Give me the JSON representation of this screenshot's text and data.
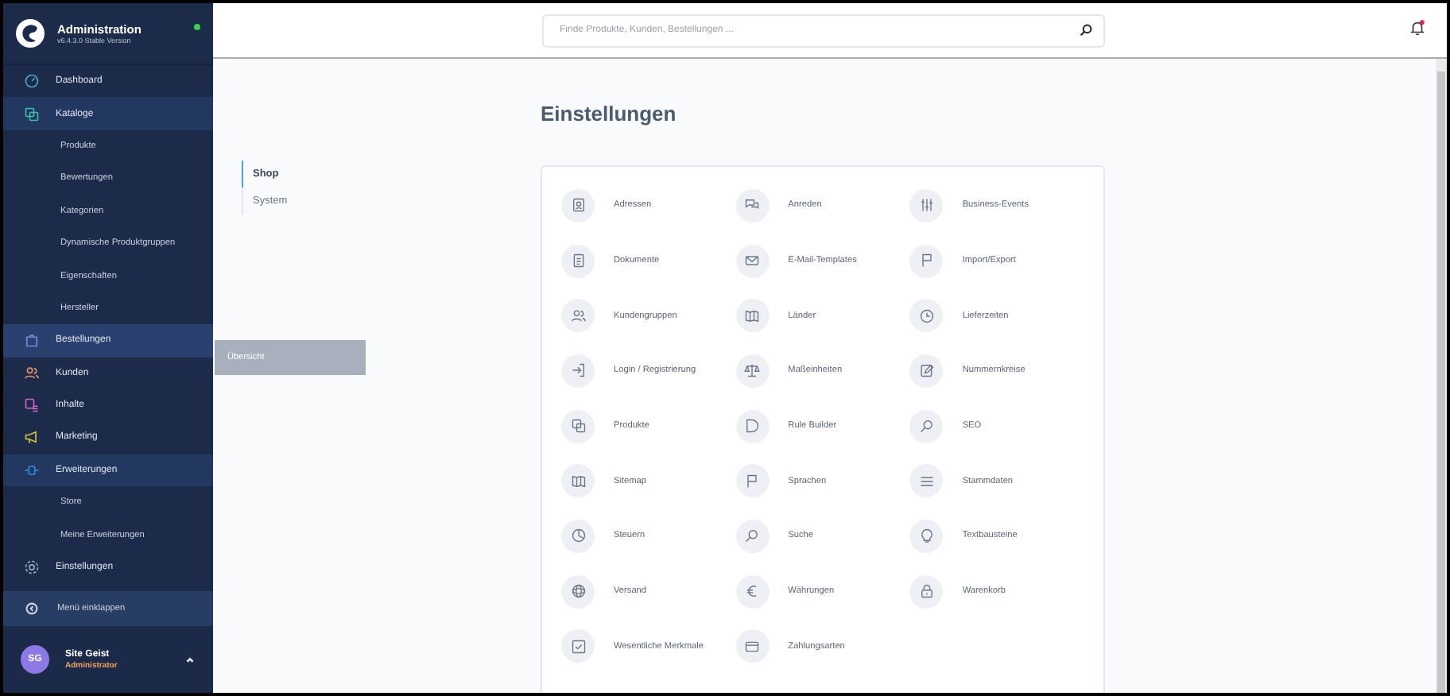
{
  "sidebar": {
    "title": "Administration",
    "version": "v6.4.3.0 Stable Version",
    "online": true,
    "items": [
      {
        "label": "Dashboard",
        "color": "#4fa8c9",
        "expanded": false,
        "selected": false
      },
      {
        "label": "Kataloge",
        "color": "#3fbf9e",
        "expanded": true,
        "selected": false,
        "children": [
          {
            "label": "Produkte"
          },
          {
            "label": "Bewertungen"
          },
          {
            "label": "Kategorien"
          },
          {
            "label": "Dynamische Produktgruppen"
          },
          {
            "label": "Eigenschaften"
          },
          {
            "label": "Hersteller"
          }
        ]
      },
      {
        "label": "Bestellungen",
        "color": "#6c8fd8",
        "expanded": false,
        "selected": true
      },
      {
        "label": "Kunden",
        "color": "#e8906a",
        "expanded": false,
        "selected": false
      },
      {
        "label": "Inhalte",
        "color": "#d062c9",
        "expanded": false,
        "selected": false
      },
      {
        "label": "Marketing",
        "color": "#d6c43a",
        "expanded": false,
        "selected": false
      },
      {
        "label": "Erweiterungen",
        "color": "#2f8fe0",
        "expanded": true,
        "selected": false,
        "children": [
          {
            "label": "Store"
          },
          {
            "label": "Meine Erweiterungen"
          }
        ]
      },
      {
        "label": "Einstellungen",
        "color": "#9aa5b8",
        "expanded": false,
        "selected": false
      }
    ],
    "flyout": [
      "Übersicht"
    ],
    "collapse": "Menü einklappen",
    "user": {
      "initials": "SG",
      "name": "Site Geist",
      "role": "Administrator"
    }
  },
  "search": {
    "placeholder": "Finde Produkte, Kunden, Bestellungen ..."
  },
  "notification": true,
  "page_title": "Einstellungen",
  "tabs": [
    {
      "label": "Shop",
      "selected": true
    },
    {
      "label": "System",
      "selected": false
    }
  ],
  "settings": [
    {
      "label": "Adressen"
    },
    {
      "label": "Anreden"
    },
    {
      "label": "Business-Events"
    },
    {
      "label": "Dokumente"
    },
    {
      "label": "E-Mail-Templates"
    },
    {
      "label": "Import/Export"
    },
    {
      "label": "Kundengruppen"
    },
    {
      "label": "Länder"
    },
    {
      "label": "Lieferzeiten"
    },
    {
      "label": "Login / Registrierung"
    },
    {
      "label": "Maßeinheiten"
    },
    {
      "label": "Nummernkreise"
    },
    {
      "label": "Produkte"
    },
    {
      "label": "Rule Builder"
    },
    {
      "label": "SEO"
    },
    {
      "label": "Sitemap"
    },
    {
      "label": "Sprachen"
    },
    {
      "label": "Stammdaten"
    },
    {
      "label": "Steuern"
    },
    {
      "label": "Suche"
    },
    {
      "label": "Textbausteine"
    },
    {
      "label": "Versand"
    },
    {
      "label": "Währungen"
    },
    {
      "label": "Warenkorb"
    },
    {
      "label": "Wesentliche Merkmale"
    },
    {
      "label": "Zahlungsarten"
    }
  ]
}
